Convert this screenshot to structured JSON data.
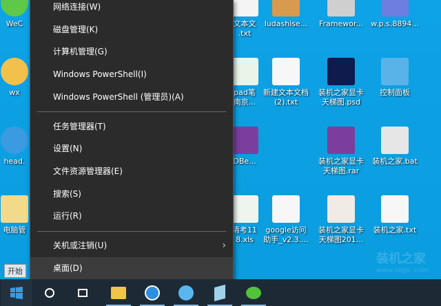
{
  "desktop": {
    "left_icons": [
      "WeC",
      "wx",
      "head.",
      "电脑管"
    ],
    "icons": [
      {
        "label": "文本文\n.txt",
        "color": "#f4f4f4"
      },
      {
        "label": "ludashise...",
        "color": "#d79a4f"
      },
      {
        "label": "Framewor...",
        "color": "#cfcfcf"
      },
      {
        "label": "w.p.s.8894...",
        "color": "#6d7ee0"
      },
      {
        "label": "pad笔\n南京...",
        "color": "#e8f5e8"
      },
      {
        "label": "新建文本文档\n(2).txt",
        "color": "#f7f7f7"
      },
      {
        "label": "装机之家显卡\n天梯图.psd",
        "color": "#0f1b4d"
      },
      {
        "label": "控制面板",
        "color": "#5ab3e8"
      },
      {
        "label": "DBe...",
        "color": "#7a3f9e"
      },
      {
        "label": "装机之家显卡\n天梯图.rar",
        "color": "#7a3f9e"
      },
      {
        "label": "装机之家.bat",
        "color": "#e6e6e6"
      },
      {
        "label": "清考11\n8.xls",
        "color": "#eef5ee"
      },
      {
        "label": "google访问\n助手_v2.3....",
        "color": "#f7f7f7"
      },
      {
        "label": "装机之家显卡\n天梯图201...",
        "color": "#f0ebe4"
      },
      {
        "label": "装机之家.txt",
        "color": "#f7f7f7"
      }
    ]
  },
  "menu": {
    "items": [
      {
        "label": "网络连接(W)"
      },
      {
        "label": "磁盘管理(K)"
      },
      {
        "label": "计算机管理(G)"
      },
      {
        "label": "Windows PowerShell(I)"
      },
      {
        "label": "Windows PowerShell (管理员)(A)"
      },
      {
        "label": "任务管理器(T)"
      },
      {
        "label": "设置(N)"
      },
      {
        "label": "文件资源管理器(E)"
      },
      {
        "label": "搜索(S)"
      },
      {
        "label": "运行(R)"
      },
      {
        "label": "关机或注销(U)",
        "submenu_arrow": "›"
      },
      {
        "label": "桌面(D)"
      }
    ]
  },
  "start_tooltip": "开始",
  "watermark": {
    "text": "装机之家",
    "url": "www.lotpc.com"
  }
}
